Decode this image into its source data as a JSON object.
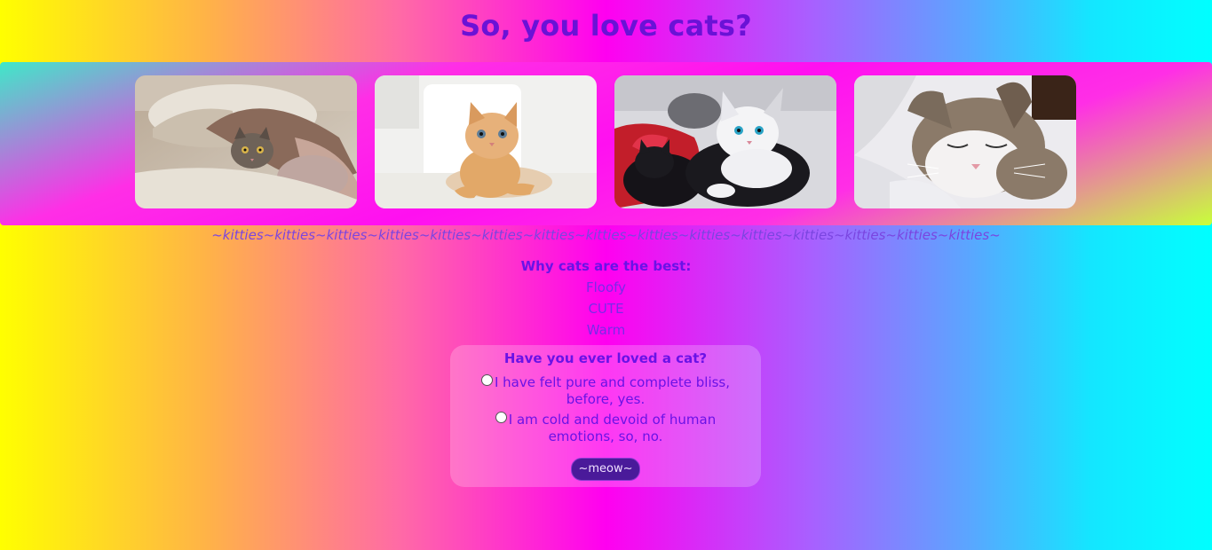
{
  "page": {
    "title": "So, you love cats?"
  },
  "gallery": {
    "images": [
      {
        "subject": "tabby-kitten-under-blanket"
      },
      {
        "subject": "orange-kitten-on-sofa"
      },
      {
        "subject": "black-and-white-kittens-cuddling"
      },
      {
        "subject": "sleeping-tabby-white-cat"
      }
    ]
  },
  "kitties_banner": "~kitties~kitties~kitties~kitties~kitties~kitties~kitties~kitties~kitties~kitties~kitties~kitties~kitties~kitties~kitties~",
  "reasons": {
    "heading": "Why cats are the best:",
    "items": [
      "Floofy",
      "CUTE",
      "Warm"
    ]
  },
  "quiz": {
    "question": "Have you ever loved a cat?",
    "options": [
      "I have felt pure and complete bliss, before, yes.",
      "I am cold and devoid of human emotions, so, no."
    ],
    "submit_label": "~meow~"
  },
  "colors": {
    "heading": "#6a12d6",
    "button_bg": "#4a1a9a"
  }
}
